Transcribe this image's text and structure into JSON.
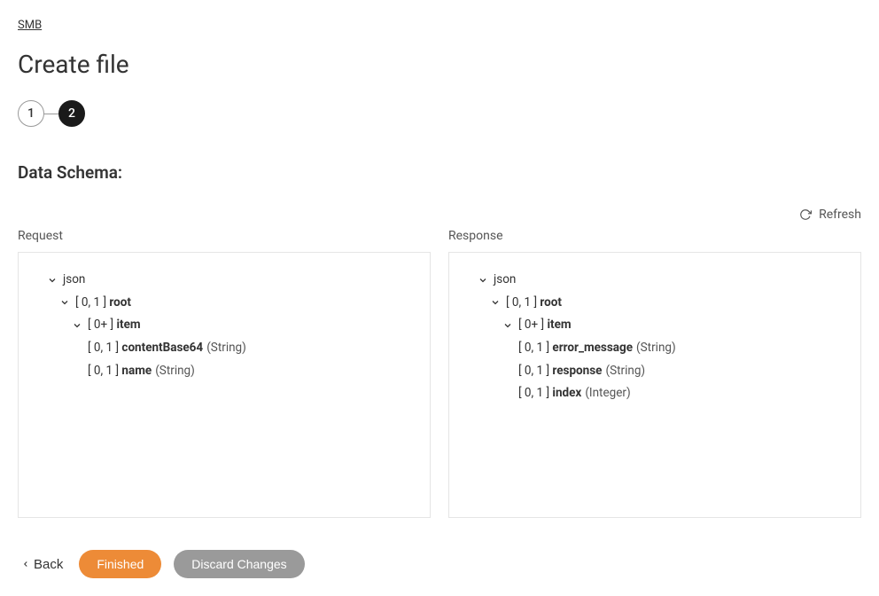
{
  "breadcrumb": "SMB",
  "page_title": "Create file",
  "stepper": {
    "step1": "1",
    "step2": "2"
  },
  "section_title": "Data Schema:",
  "refresh_label": "Refresh",
  "panels": {
    "request": {
      "label": "Request",
      "tree": {
        "root_label": "json",
        "root_card": "[ 0, 1 ]",
        "root_name": "root",
        "item_card": "[ 0+ ]",
        "item_name": "item",
        "fields": [
          {
            "card": "[ 0, 1 ]",
            "name": "contentBase64",
            "type": "(String)"
          },
          {
            "card": "[ 0, 1 ]",
            "name": "name",
            "type": "(String)"
          }
        ]
      }
    },
    "response": {
      "label": "Response",
      "tree": {
        "root_label": "json",
        "root_card": "[ 0, 1 ]",
        "root_name": "root",
        "item_card": "[ 0+ ]",
        "item_name": "item",
        "fields": [
          {
            "card": "[ 0, 1 ]",
            "name": "error_message",
            "type": "(String)"
          },
          {
            "card": "[ 0, 1 ]",
            "name": "response",
            "type": "(String)"
          },
          {
            "card": "[ 0, 1 ]",
            "name": "index",
            "type": "(Integer)"
          }
        ]
      }
    }
  },
  "footer": {
    "back": "Back",
    "finished": "Finished",
    "discard": "Discard Changes"
  }
}
